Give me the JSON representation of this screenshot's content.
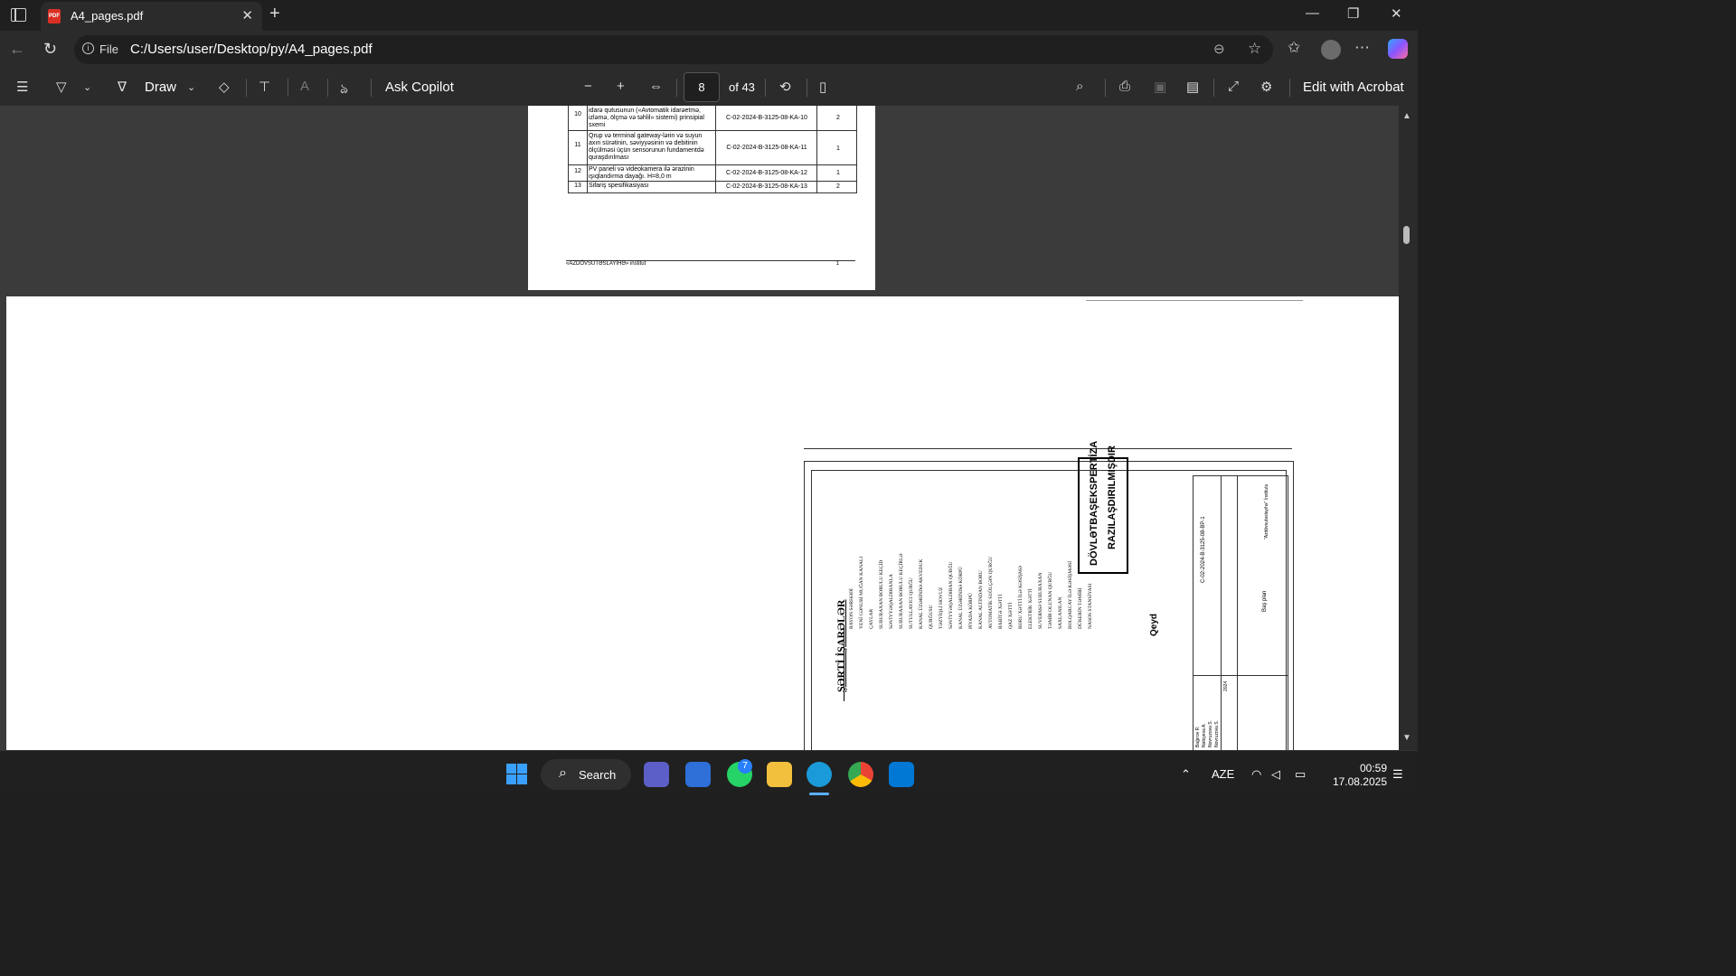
{
  "tab": {
    "title": "A4_pages.pdf",
    "favicon": "PDF"
  },
  "address": {
    "scheme_label": "File",
    "url": "C:/Users/user/Desktop/py/A4_pages.pdf"
  },
  "pdf_toolbar": {
    "draw_label": "Draw",
    "ask_copilot_label": "Ask Copilot",
    "page_number": "8",
    "page_total": "of 43",
    "edit_acrobat_label": "Edit with Acrobat"
  },
  "page1": {
    "rows": [
      {
        "n": "10",
        "desc": "idarə qutusunun («Avtomatik idarəetmə, izləmə, ölçmə və təhlil» sistemi) prinsipial sxemi",
        "code": "C-02-2024-B-3125-08-KA-10",
        "qty": "2"
      },
      {
        "n": "11",
        "desc": "Qrup və terminal gateway-lərin və suyun axın sürətinin, səviyyəsinin və debitinin ölçülməsi üçün sensorunun fundamentdə quraşdırılması",
        "code": "C-02-2024-B-3125-08-KA-11",
        "qty": "1"
      },
      {
        "n": "12",
        "desc": "PV paneli və videokamera ilə ərazinin işıqlandırma dayağı. H=8,0 m",
        "code": "C-02-2024-B-3125-08-KA-12",
        "qty": "1"
      },
      {
        "n": "13",
        "desc": "Sifariş spesifikasiyası",
        "code": "C-02-2024-B-3125-08-KA-13",
        "qty": "2"
      }
    ],
    "footer_left": "«AZDÖVSUTƏSLAYİHƏ» institut",
    "footer_right": "1"
  },
  "page2": {
    "legend_title": "ŞƏRTİ İŞARƏLƏR",
    "legend_items": [
      "RAYON SƏRHƏDİ",
      "YENİ CƏNUBİ MUĞAN KANALI",
      "ÇAYLAR",
      "SUBURAXAN BORULU KEÇİD",
      "SƏVİYYƏQALDIRANLA",
      "SUBURAXAN BORULU KEÇİRLƏ",
      "SUTULLAYICI QURĞU",
      "KANAL ÜZƏRİNDƏ AKVEDUK",
      "QURĞUSU",
      "TƏZYİQLİ HOVUZ",
      "SƏVİYYƏQALDIRAN QURĞU",
      "KANAL ÜZƏRİNDƏ KÖRPÜ",
      "PİYADA KÖRPÜ",
      "KANAL ALTINDAN BORU",
      "AVTOMATİK SUÖLÇƏN QURĞU",
      "RABİTƏ XƏTTİ",
      "QAZ XƏTTİ",
      "BORU XƏTTİ İLƏ KƏSİŞMƏ",
      "ELEKTRİK XƏTTİ",
      "SUVERMƏ SUBURAXAN",
      "TƏMİR OLUNAN QURĞU",
      "SAXLANILAN",
      "BOLQARCAY İLƏ KƏSİŞMƏSİ",
      "DÜKERİN TƏMİRİ",
      "NASOS STANSİYASI"
    ],
    "stamp_line1": "DÖVLƏTBAŞEKSPERTİZA",
    "stamp_line2": "RAZILAŞDIRILMIŞDIR",
    "note_label": "Qeyd",
    "title_block": {
      "code": "C-02-2024-B-3125-08-BP-1",
      "sheet_name": "Baş plan",
      "org": "\"Azdövsutəslayihə\" İnstitutu",
      "year": "2024",
      "names": [
        "Bağırov R.",
        "Nəbiyeva A.",
        "Novruzova S.",
        "Novruzova S."
      ]
    }
  },
  "taskbar": {
    "search_label": "Search",
    "whatsapp_badge": "7",
    "lang": "AZE",
    "time": "00:59",
    "date": "17.08.2025"
  },
  "colors": {
    "accent_blue": "#2980ff",
    "pdf_red": "#d93025",
    "chrome_bg": "#1f1f1f",
    "toolbar_bg": "#2b2b2b"
  }
}
